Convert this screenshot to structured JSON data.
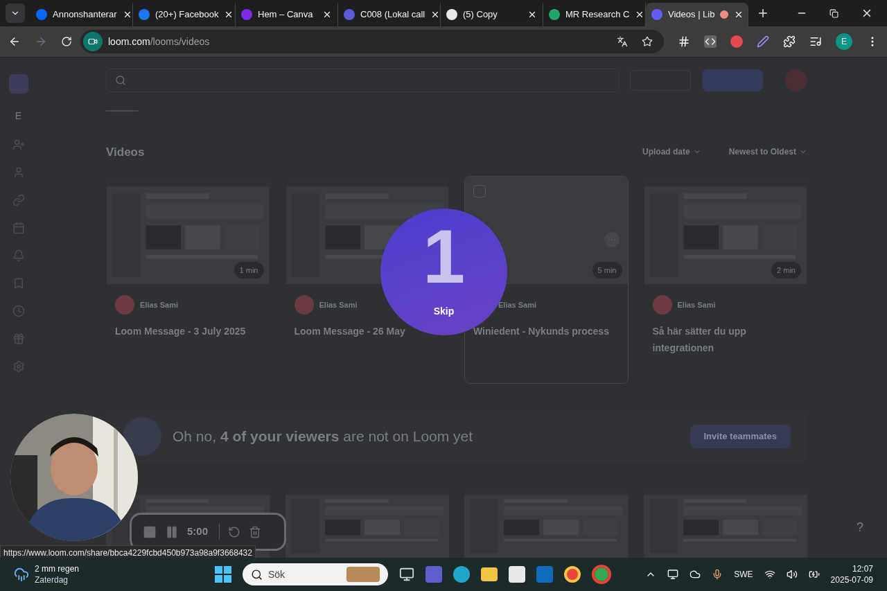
{
  "tabs": [
    {
      "title": "Annonshanterar",
      "color": "#0866ff",
      "selected": false,
      "recording": false
    },
    {
      "title": "(20+) Facebook",
      "color": "#1877f2",
      "selected": false,
      "recording": false
    },
    {
      "title": "Hem – Canva",
      "color": "#7d2ae8",
      "selected": false,
      "recording": false
    },
    {
      "title": "C008 (Lokal call",
      "color": "#5b5bd6",
      "selected": false,
      "recording": false
    },
    {
      "title": "(5) Copy",
      "color": "#e8e8e8",
      "selected": false,
      "recording": false
    },
    {
      "title": "MR Research C",
      "color": "#23a566",
      "selected": false,
      "recording": false
    },
    {
      "title": "Videos | Lib",
      "color": "#625df5",
      "selected": true,
      "recording": true
    }
  ],
  "address": {
    "host": "loom.com",
    "path": "/looms/videos"
  },
  "profile": "E",
  "page": {
    "workspace_initial": "E",
    "heading": "Videos",
    "sort": [
      "Upload date",
      "Newest to Oldest"
    ],
    "cards": [
      {
        "author": "Elias Sami",
        "avatar": true,
        "title": "Loom Message - 3 July 2025",
        "duration": "1 min",
        "hovered": false
      },
      {
        "author": "Elias Sami",
        "avatar": true,
        "title": "Loom Message - 26 May",
        "hovered": false
      },
      {
        "author": "Elias Sami",
        "avatar": false,
        "title": "Winiedent - Nykunds process",
        "duration": "5 min",
        "hovered": true
      },
      {
        "author": "Elias Sami",
        "avatar": true,
        "title": "Så här sätter du upp integrationen",
        "duration": "2 min",
        "hovered": false
      }
    ],
    "banner": {
      "text": "Oh no, **4 of your viewers** are not on Loom yet",
      "button": "Invite teammates"
    },
    "help": "?"
  },
  "countdown": {
    "number": "1",
    "skip": "Skip"
  },
  "recorder": {
    "time": "5:00"
  },
  "status_url": "https://www.loom.com/share/bbca4229fcbd450b973a98a9f3668432",
  "taskbar": {
    "weather": "2 mm regen",
    "day": "Zaterdag",
    "search": "Sök",
    "language": "SWE",
    "time": "12:07",
    "date": "2025-07-09"
  }
}
